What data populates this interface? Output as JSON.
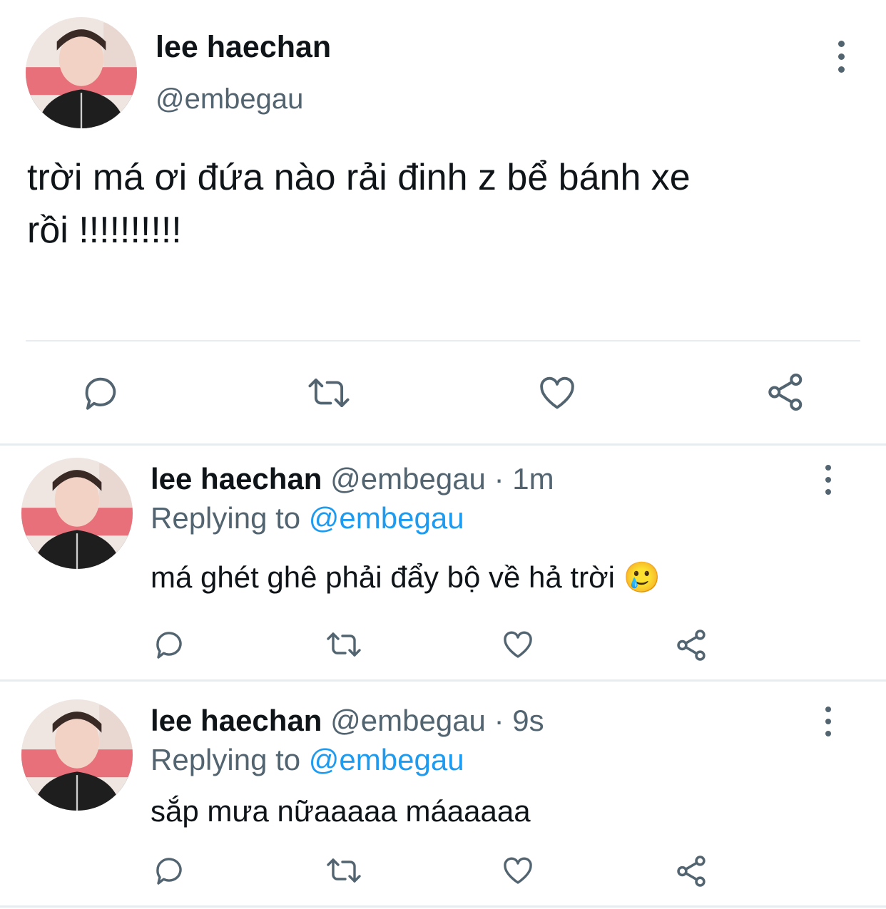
{
  "main_tweet": {
    "display_name": "lee haechan",
    "handle": "@embegau",
    "text_line1": "trời má ơi đứa nào rải đinh z bể bánh xe",
    "text_line2": "rồi !!!!!!!!!!"
  },
  "replies": [
    {
      "display_name": "lee haechan",
      "handle": "@embegau",
      "time": "· 1m",
      "replying_prefix": "Replying to",
      "replying_handle": "@embegau",
      "text": "má ghét ghê phải đẩy bộ về hả trời 🥲"
    },
    {
      "display_name": "lee haechan",
      "handle": "@embegau",
      "time": "· 9s",
      "replying_prefix": "Replying to",
      "replying_handle": "@embegau",
      "text": "sắp mưa nữaaaaa máaaaaa"
    }
  ],
  "icons": {
    "reply": "reply-icon",
    "retweet": "retweet-icon",
    "like": "heart-icon",
    "share": "share-icon",
    "more": "more-vertical-icon"
  },
  "colors": {
    "text": "#0f1419",
    "muted": "#536471",
    "link": "#1d9bf0",
    "divider": "#e6ecf0"
  }
}
